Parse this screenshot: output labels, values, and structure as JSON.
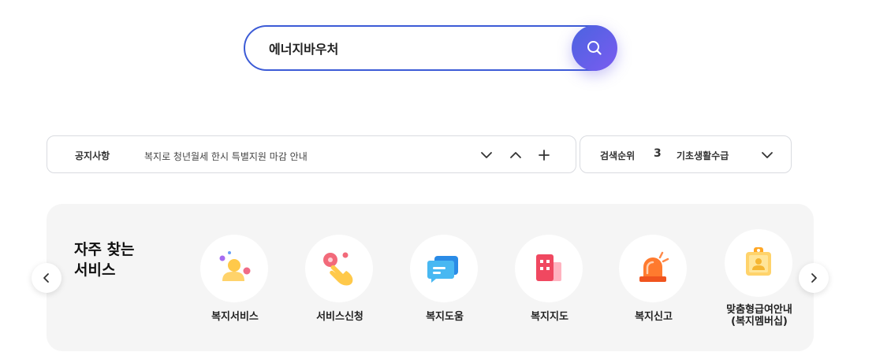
{
  "search": {
    "value": "에너지바우처"
  },
  "notice": {
    "label": "공지사항",
    "text": "복지로 청년월세 한시 특별지원 마감 안내"
  },
  "rank": {
    "label": "검색순위",
    "number": "3",
    "text": "기초생활수급"
  },
  "services": {
    "title_line1": "자주 찾는",
    "title_line2": "서비스",
    "items": [
      {
        "label": "복지서비스",
        "icon": "person-icon"
      },
      {
        "label": "서비스신청",
        "icon": "hand-tap-icon"
      },
      {
        "label": "복지도움",
        "icon": "chat-bubble-icon"
      },
      {
        "label": "복지지도",
        "icon": "building-map-icon"
      },
      {
        "label": "복지신고",
        "icon": "siren-icon"
      },
      {
        "label_line1": "맞춤형급여안내",
        "label_line2": "(복지멤버십)",
        "icon": "membership-card-icon"
      }
    ]
  },
  "colors": {
    "accent": "#3c5bd6",
    "search_button_gradient_start": "#4b63e0",
    "search_button_gradient_end": "#7a5cf0",
    "panel_background": "#f5f5f5"
  }
}
